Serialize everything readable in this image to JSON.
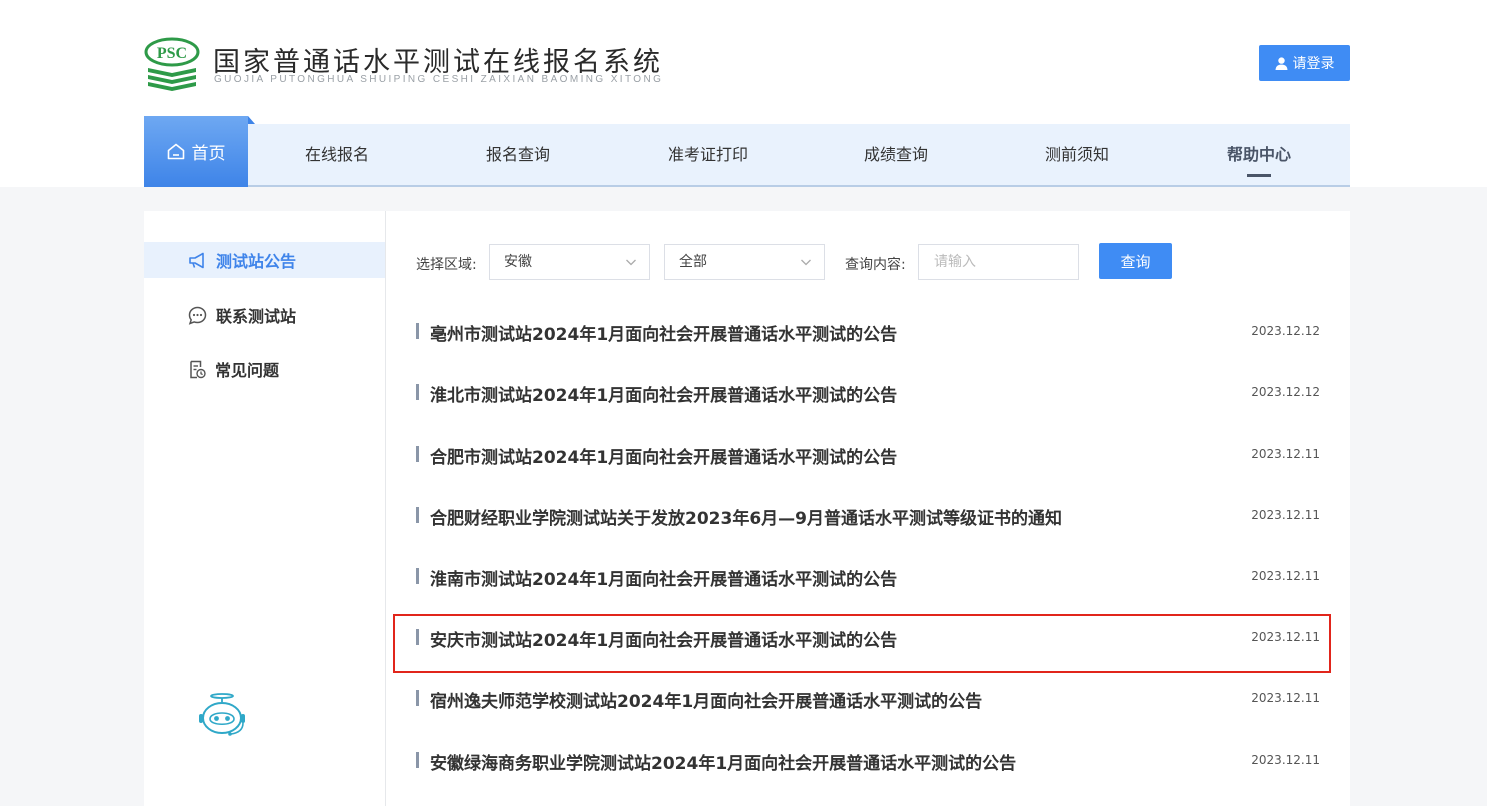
{
  "header": {
    "logo_text": "PSC",
    "title": "国家普通话水平测试在线报名系统",
    "subtitle": "GUOJIA PUTONGHUA SHUIPING CESHI ZAIXIAN BAOMING XITONG",
    "login_label": "请登录"
  },
  "nav": {
    "home": "首页",
    "items": [
      "在线报名",
      "报名查询",
      "准考证打印",
      "成绩查询",
      "测前须知",
      "帮助中心"
    ],
    "active": "帮助中心"
  },
  "sidebar": {
    "items": [
      {
        "label": "测试站公告",
        "icon": "megaphone-icon",
        "active": true
      },
      {
        "label": "联系测试站",
        "icon": "chat-bubble-icon",
        "active": false
      },
      {
        "label": "常见问题",
        "icon": "document-clock-icon",
        "active": false
      }
    ]
  },
  "filters": {
    "region_label": "选择区域:",
    "province": "安徽",
    "city": "全部",
    "query_label": "查询内容:",
    "query_placeholder": "请输入",
    "query_button": "查询"
  },
  "notices": [
    {
      "title": "亳州市测试站2024年1月面向社会开展普通话水平测试的公告",
      "date": "2023.12.12"
    },
    {
      "title": "淮北市测试站2024年1月面向社会开展普通话水平测试的公告",
      "date": "2023.12.12"
    },
    {
      "title": "合肥市测试站2024年1月面向社会开展普通话水平测试的公告",
      "date": "2023.12.11"
    },
    {
      "title": "合肥财经职业学院测试站关于发放2023年6月—9月普通话水平测试等级证书的通知",
      "date": "2023.12.11"
    },
    {
      "title": "淮南市测试站2024年1月面向社会开展普通话水平测试的公告",
      "date": "2023.12.11"
    },
    {
      "title": "安庆市测试站2024年1月面向社会开展普通话水平测试的公告",
      "date": "2023.12.11"
    },
    {
      "title": "宿州逸夫师范学校测试站2024年1月面向社会开展普通话水平测试的公告",
      "date": "2023.12.11"
    },
    {
      "title": "安徽绿海商务职业学院测试站2024年1月面向社会开展普通话水平测试的公告",
      "date": "2023.12.11"
    }
  ],
  "highlighted_notice": "安庆市测试站2024年1月面向社会开展普通话水平测试的公告",
  "colors": {
    "accent": "#3f8cf4",
    "logo_green": "#2e9a48",
    "highlight": "#e1251b",
    "nav_bg": "#e9f2fd"
  }
}
